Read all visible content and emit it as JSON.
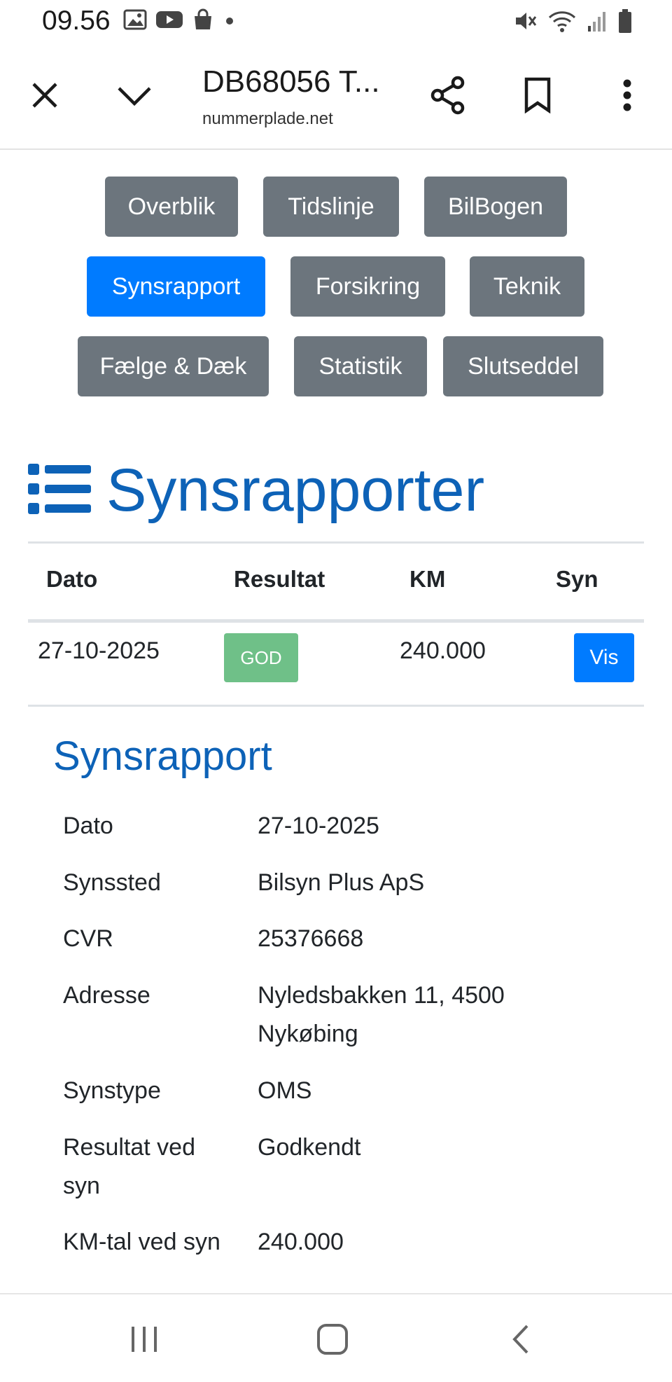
{
  "status_bar": {
    "time": "09.56",
    "left_icons": [
      "image-icon",
      "youtube-icon",
      "shopping-bag-icon",
      "dot-icon"
    ],
    "right_icons": [
      "mute-icon",
      "wifi-icon",
      "signal-icon",
      "battery-icon"
    ]
  },
  "browser": {
    "title": "DB68056 T...",
    "domain": "nummerplade.net",
    "icons": [
      "close-icon",
      "chevron-down-icon",
      "share-icon",
      "bookmark-icon",
      "more-vert-icon"
    ]
  },
  "nav": {
    "buttons": [
      {
        "label": "Overblik",
        "active": false
      },
      {
        "label": "Tidslinje",
        "active": false
      },
      {
        "label": "BilBogen",
        "active": false
      },
      {
        "label": "Synsrapport",
        "active": true
      },
      {
        "label": "Forsikring",
        "active": false
      },
      {
        "label": "Teknik",
        "active": false
      },
      {
        "label": "Fælge & Dæk",
        "active": false
      },
      {
        "label": "Statistik",
        "active": false
      },
      {
        "label": "Slutseddel",
        "active": false
      }
    ]
  },
  "main": {
    "heading": "Synsrapporter",
    "heading_icon": "list-icon",
    "table": {
      "headers": [
        "Dato",
        "Resultat",
        "KM",
        "Syn"
      ],
      "rows": [
        {
          "dato": "27-10-2025",
          "resultat": "GOD",
          "km": "240.000",
          "syn": "Vis"
        }
      ]
    }
  },
  "detail": {
    "heading": "Synsrapport",
    "rows": [
      {
        "label": "Dato",
        "value": "27-10-2025"
      },
      {
        "label": "Synssted",
        "value": "Bilsyn Plus ApS"
      },
      {
        "label": "CVR",
        "value": "25376668"
      },
      {
        "label": "Adresse",
        "value": "Nyledsbakken 11, 4500 Nykøbing"
      },
      {
        "label": "Synstype",
        "value": "OMS"
      },
      {
        "label": "Resultat ved syn",
        "value": "Godkendt"
      },
      {
        "label": "KM-tal ved syn",
        "value": "240.000"
      }
    ]
  },
  "colors": {
    "primary": "#007bff",
    "secondary": "#6c757d",
    "heading": "#0d62b7",
    "success_badge": "#6fc088"
  },
  "bottom_nav": {
    "icons": [
      "recent-apps-icon",
      "home-icon",
      "back-icon"
    ]
  }
}
